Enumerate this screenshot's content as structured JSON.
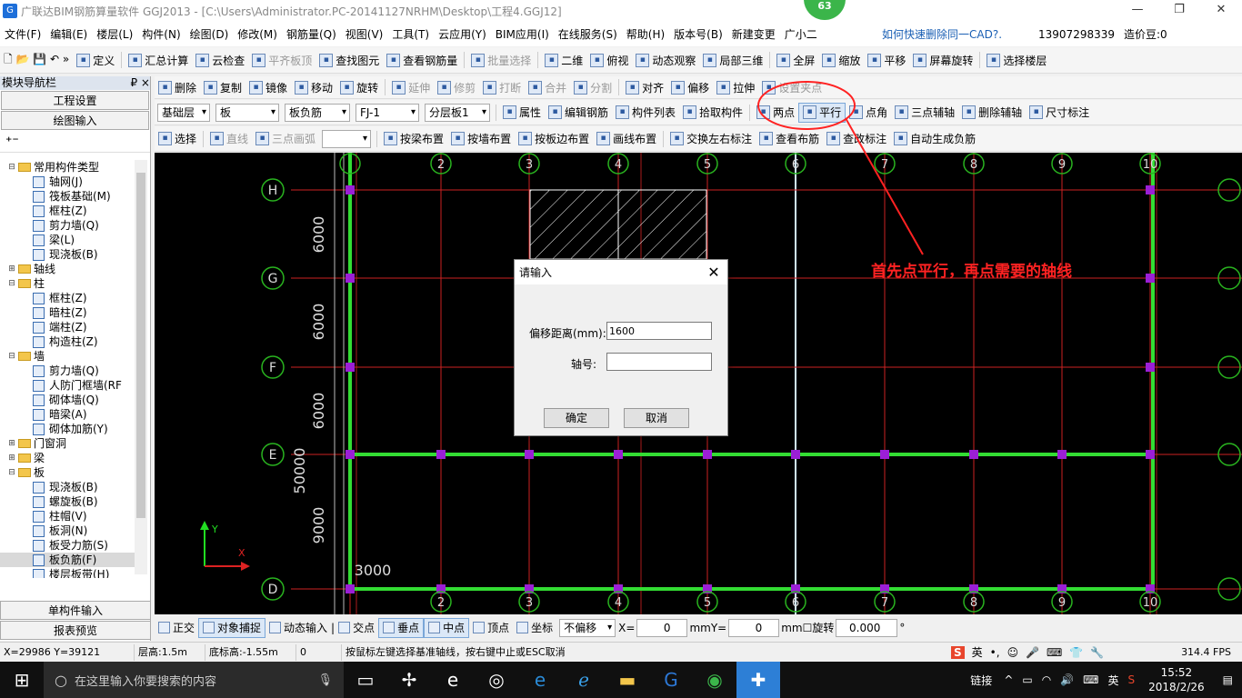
{
  "window": {
    "title": "广联达BIM钢筋算量软件 GGJ2013 - [C:\\Users\\Administrator.PC-20141127NRHM\\Desktop\\工程4.GGJ12]",
    "badge": "63"
  },
  "menu": {
    "items": [
      "文件(F)",
      "编辑(E)",
      "楼层(L)",
      "构件(N)",
      "绘图(D)",
      "修改(M)",
      "钢筋量(Q)",
      "视图(V)",
      "工具(T)",
      "云应用(Y)",
      "BIM应用(I)",
      "在线服务(S)",
      "帮助(H)",
      "版本号(B)",
      "新建变更",
      "广小二"
    ],
    "link": "如何快速删除同一CAD?.",
    "phone": "13907298339",
    "coins": "造价豆:0"
  },
  "toolbar1": [
    "定义",
    "汇总计算",
    "云检查",
    "平齐板顶",
    "查找图元",
    "查看钢筋量",
    "批量选择",
    "二维",
    "俯视",
    "动态观察",
    "局部三维",
    "全屏",
    "缩放",
    "平移",
    "屏幕旋转",
    "选择楼层"
  ],
  "toolbar2": [
    "删除",
    "复制",
    "镜像",
    "移动",
    "旋转",
    "延伸",
    "修剪",
    "打断",
    "合并",
    "分割",
    "对齐",
    "偏移",
    "拉伸",
    "设置夹点"
  ],
  "toolbar3": {
    "combos": [
      "基础层",
      "板",
      "板负筋",
      "FJ-1",
      "分层板1"
    ],
    "buttons": [
      "属性",
      "编辑钢筋",
      "构件列表",
      "拾取构件",
      "两点",
      "平行",
      "点角",
      "三点辅轴",
      "删除辅轴",
      "尺寸标注"
    ]
  },
  "toolbar4": [
    "选择",
    "直线",
    "三点画弧",
    "按梁布置",
    "按墙布置",
    "按板边布置",
    "画线布置",
    "交换左右标注",
    "查看布筋",
    "查改标注",
    "自动生成负筋"
  ],
  "nav": {
    "title": "模块导航栏",
    "pin": "₽ ×",
    "btn1": "工程设置",
    "btn2": "绘图输入",
    "btn3": "单构件输入",
    "btn4": "报表预览",
    "tree": [
      {
        "t": "常用构件类型",
        "lvl": 0,
        "folder": true,
        "exp": "⊟"
      },
      {
        "t": "轴网(J)",
        "lvl": 1
      },
      {
        "t": "筏板基础(M)",
        "lvl": 1
      },
      {
        "t": "框柱(Z)",
        "lvl": 1
      },
      {
        "t": "剪力墙(Q)",
        "lvl": 1
      },
      {
        "t": "梁(L)",
        "lvl": 1
      },
      {
        "t": "现浇板(B)",
        "lvl": 1
      },
      {
        "t": "轴线",
        "lvl": 0,
        "folder": true,
        "exp": "⊞"
      },
      {
        "t": "柱",
        "lvl": 0,
        "folder": true,
        "exp": "⊟"
      },
      {
        "t": "框柱(Z)",
        "lvl": 1
      },
      {
        "t": "暗柱(Z)",
        "lvl": 1
      },
      {
        "t": "端柱(Z)",
        "lvl": 1
      },
      {
        "t": "构造柱(Z)",
        "lvl": 1
      },
      {
        "t": "墙",
        "lvl": 0,
        "folder": true,
        "exp": "⊟"
      },
      {
        "t": "剪力墙(Q)",
        "lvl": 1
      },
      {
        "t": "人防门框墙(RF",
        "lvl": 1
      },
      {
        "t": "砌体墙(Q)",
        "lvl": 1
      },
      {
        "t": "暗梁(A)",
        "lvl": 1
      },
      {
        "t": "砌体加筋(Y)",
        "lvl": 1
      },
      {
        "t": "门窗洞",
        "lvl": 0,
        "folder": true,
        "exp": "⊞"
      },
      {
        "t": "梁",
        "lvl": 0,
        "folder": true,
        "exp": "⊞"
      },
      {
        "t": "板",
        "lvl": 0,
        "folder": true,
        "exp": "⊟"
      },
      {
        "t": "现浇板(B)",
        "lvl": 1
      },
      {
        "t": "螺旋板(B)",
        "lvl": 1
      },
      {
        "t": "柱帽(V)",
        "lvl": 1
      },
      {
        "t": "板洞(N)",
        "lvl": 1
      },
      {
        "t": "板受力筋(S)",
        "lvl": 1
      },
      {
        "t": "板负筋(F)",
        "lvl": 1,
        "sel": true
      },
      {
        "t": "楼层板带(H)",
        "lvl": 1
      }
    ]
  },
  "drawing": {
    "col_labels": [
      "2",
      "3",
      "4",
      "5",
      "6",
      "7",
      "8",
      "9",
      "10"
    ],
    "row_labels": [
      "H",
      "G",
      "F",
      "E",
      "D"
    ],
    "dims": [
      "6000",
      "6000",
      "6000",
      "9000",
      "50000",
      "3000"
    ],
    "axis_x": "X",
    "axis_y": "Y"
  },
  "dialog": {
    "title": "请输入",
    "offset_label": "偏移距离(mm):",
    "offset_value": "1600",
    "axis_label": "轴号:",
    "axis_value": "",
    "ok": "确定",
    "cancel": "取消"
  },
  "annotation": "首先点平行，再点需要的轴线",
  "bottom_toolbar": {
    "items": [
      "正交",
      "对象捕捉",
      "动态输入",
      "交点",
      "垂点",
      "中点",
      "顶点",
      "坐标"
    ],
    "offset_combo": "不偏移",
    "x_label": "X=",
    "x_value": "0",
    "y_label": "Y=",
    "y_value": "0",
    "unit": "mm",
    "rotate_label": "旋转",
    "rotate_value": "0.000"
  },
  "status": {
    "coords": "X=29986 Y=39121",
    "floor_height": "层高:1.5m",
    "bottom_height": "底标高:-1.55m",
    "zero": "0",
    "hint": "按鼠标左键选择基准轴线，按右键中止或ESC取消",
    "fps": "314.4 FPS"
  },
  "taskbar": {
    "search_placeholder": "在这里输入你要搜索的内容",
    "tray_link": "链接",
    "lang": "英",
    "time": "15:52",
    "date": "2018/2/26"
  }
}
